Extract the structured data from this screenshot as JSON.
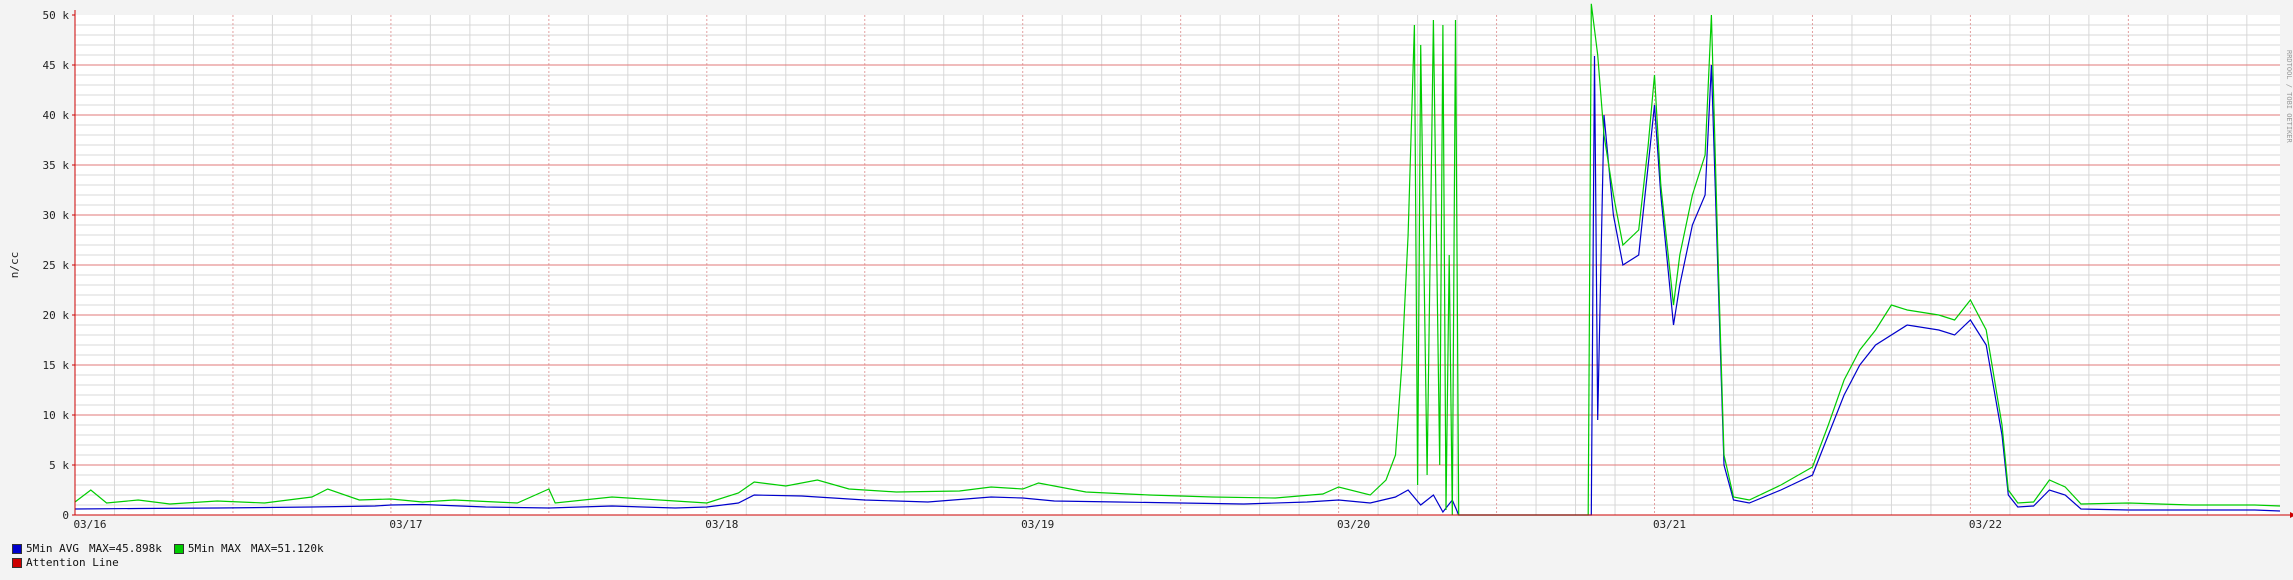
{
  "chart_data": {
    "type": "line",
    "ylabel": "n/cc",
    "ylim": [
      0,
      50000
    ],
    "y_ticks": [
      0,
      5000,
      10000,
      15000,
      20000,
      25000,
      30000,
      35000,
      40000,
      45000,
      50000
    ],
    "y_tick_labels": [
      "0",
      "5 k",
      "10 k",
      "15 k",
      "20 k",
      "25 k",
      "30 k",
      "35 k",
      "40 k",
      "45 k",
      "50 k"
    ],
    "x_range": [
      "03/16",
      "03/22 end"
    ],
    "x_tick_labels": [
      "03/16",
      "03/17",
      "03/18",
      "03/19",
      "03/20",
      "03/21",
      "03/22"
    ],
    "grid": true,
    "watermark": "RRDTOOL / TOBI OETIKER",
    "series": [
      {
        "name": "5Min AVG",
        "color": "#0000cc",
        "max_label": "MAX=45.898k",
        "points": [
          [
            0.0,
            600
          ],
          [
            0.2,
            650
          ],
          [
            0.45,
            700
          ],
          [
            0.75,
            800
          ],
          [
            0.95,
            900
          ],
          [
            1.0,
            1000
          ],
          [
            1.1,
            1050
          ],
          [
            1.3,
            800
          ],
          [
            1.5,
            700
          ],
          [
            1.7,
            900
          ],
          [
            1.9,
            700
          ],
          [
            2.0,
            800
          ],
          [
            2.1,
            1200
          ],
          [
            2.15,
            2000
          ],
          [
            2.3,
            1900
          ],
          [
            2.5,
            1500
          ],
          [
            2.7,
            1300
          ],
          [
            2.9,
            1800
          ],
          [
            3.0,
            1700
          ],
          [
            3.1,
            1400
          ],
          [
            3.3,
            1300
          ],
          [
            3.5,
            1200
          ],
          [
            3.7,
            1100
          ],
          [
            3.9,
            1300
          ],
          [
            4.0,
            1500
          ],
          [
            4.1,
            1200
          ],
          [
            4.18,
            1800
          ],
          [
            4.22,
            2500
          ],
          [
            4.26,
            1000
          ],
          [
            4.3,
            2000
          ],
          [
            4.33,
            300
          ],
          [
            4.36,
            1500
          ],
          [
            4.38,
            0
          ],
          [
            4.4,
            0
          ],
          [
            4.6,
            0
          ],
          [
            4.8,
            0
          ],
          [
            4.81,
            45898
          ],
          [
            4.82,
            9500
          ],
          [
            4.84,
            40000
          ],
          [
            4.87,
            30000
          ],
          [
            4.9,
            25000
          ],
          [
            4.95,
            26000
          ],
          [
            4.98,
            35000
          ],
          [
            5.0,
            41000
          ],
          [
            5.02,
            32000
          ],
          [
            5.06,
            19000
          ],
          [
            5.08,
            23000
          ],
          [
            5.12,
            29000
          ],
          [
            5.16,
            32000
          ],
          [
            5.18,
            45000
          ],
          [
            5.2,
            25000
          ],
          [
            5.22,
            5000
          ],
          [
            5.25,
            1500
          ],
          [
            5.3,
            1200
          ],
          [
            5.4,
            2500
          ],
          [
            5.5,
            4000
          ],
          [
            5.55,
            8000
          ],
          [
            5.6,
            12000
          ],
          [
            5.65,
            15000
          ],
          [
            5.7,
            17000
          ],
          [
            5.8,
            19000
          ],
          [
            5.9,
            18500
          ],
          [
            5.95,
            18000
          ],
          [
            6.0,
            19500
          ],
          [
            6.05,
            17000
          ],
          [
            6.1,
            8000
          ],
          [
            6.12,
            2000
          ],
          [
            6.15,
            800
          ],
          [
            6.2,
            900
          ],
          [
            6.25,
            2500
          ],
          [
            6.3,
            2000
          ],
          [
            6.35,
            600
          ],
          [
            6.5,
            500
          ],
          [
            6.7,
            500
          ],
          [
            6.9,
            500
          ],
          [
            6.98,
            400
          ]
        ]
      },
      {
        "name": "5Min MAX",
        "color": "#00cc00",
        "max_label": "MAX=51.120k",
        "points": [
          [
            0.0,
            1300
          ],
          [
            0.05,
            2500
          ],
          [
            0.1,
            1200
          ],
          [
            0.2,
            1500
          ],
          [
            0.3,
            1100
          ],
          [
            0.45,
            1400
          ],
          [
            0.6,
            1200
          ],
          [
            0.75,
            1800
          ],
          [
            0.8,
            2600
          ],
          [
            0.9,
            1500
          ],
          [
            1.0,
            1600
          ],
          [
            1.1,
            1300
          ],
          [
            1.2,
            1500
          ],
          [
            1.4,
            1200
          ],
          [
            1.5,
            2600
          ],
          [
            1.52,
            1200
          ],
          [
            1.7,
            1800
          ],
          [
            1.9,
            1400
          ],
          [
            2.0,
            1200
          ],
          [
            2.1,
            2200
          ],
          [
            2.15,
            3300
          ],
          [
            2.25,
            2900
          ],
          [
            2.35,
            3500
          ],
          [
            2.45,
            2600
          ],
          [
            2.6,
            2300
          ],
          [
            2.8,
            2400
          ],
          [
            2.9,
            2800
          ],
          [
            3.0,
            2600
          ],
          [
            3.05,
            3200
          ],
          [
            3.2,
            2300
          ],
          [
            3.4,
            2000
          ],
          [
            3.6,
            1800
          ],
          [
            3.8,
            1700
          ],
          [
            3.95,
            2100
          ],
          [
            4.0,
            2800
          ],
          [
            4.1,
            2000
          ],
          [
            4.15,
            3500
          ],
          [
            4.18,
            6000
          ],
          [
            4.2,
            15000
          ],
          [
            4.22,
            28000
          ],
          [
            4.24,
            49000
          ],
          [
            4.25,
            3000
          ],
          [
            4.26,
            47000
          ],
          [
            4.28,
            4000
          ],
          [
            4.3,
            49500
          ],
          [
            4.32,
            5000
          ],
          [
            4.33,
            49000
          ],
          [
            4.34,
            500
          ],
          [
            4.35,
            26000
          ],
          [
            4.36,
            0
          ],
          [
            4.37,
            49500
          ],
          [
            4.38,
            0
          ],
          [
            4.4,
            0
          ],
          [
            4.6,
            0
          ],
          [
            4.79,
            0
          ],
          [
            4.8,
            51120
          ],
          [
            4.82,
            46000
          ],
          [
            4.84,
            38000
          ],
          [
            4.87,
            32000
          ],
          [
            4.9,
            27000
          ],
          [
            4.95,
            28500
          ],
          [
            4.98,
            37000
          ],
          [
            5.0,
            44000
          ],
          [
            5.02,
            33000
          ],
          [
            5.06,
            21000
          ],
          [
            5.08,
            26000
          ],
          [
            5.12,
            32000
          ],
          [
            5.16,
            36000
          ],
          [
            5.18,
            50000
          ],
          [
            5.2,
            27000
          ],
          [
            5.22,
            6000
          ],
          [
            5.25,
            1800
          ],
          [
            5.3,
            1500
          ],
          [
            5.4,
            3000
          ],
          [
            5.5,
            4800
          ],
          [
            5.55,
            9000
          ],
          [
            5.6,
            13500
          ],
          [
            5.65,
            16500
          ],
          [
            5.7,
            18500
          ],
          [
            5.75,
            21000
          ],
          [
            5.8,
            20500
          ],
          [
            5.9,
            20000
          ],
          [
            5.95,
            19500
          ],
          [
            6.0,
            21500
          ],
          [
            6.05,
            18500
          ],
          [
            6.1,
            9000
          ],
          [
            6.12,
            2500
          ],
          [
            6.15,
            1200
          ],
          [
            6.2,
            1300
          ],
          [
            6.25,
            3500
          ],
          [
            6.3,
            2800
          ],
          [
            6.35,
            1100
          ],
          [
            6.5,
            1200
          ],
          [
            6.7,
            1000
          ],
          [
            6.9,
            1000
          ],
          [
            6.98,
            900
          ]
        ]
      },
      {
        "name": "Attention Line",
        "color": "#cc0000",
        "points": []
      }
    ]
  }
}
